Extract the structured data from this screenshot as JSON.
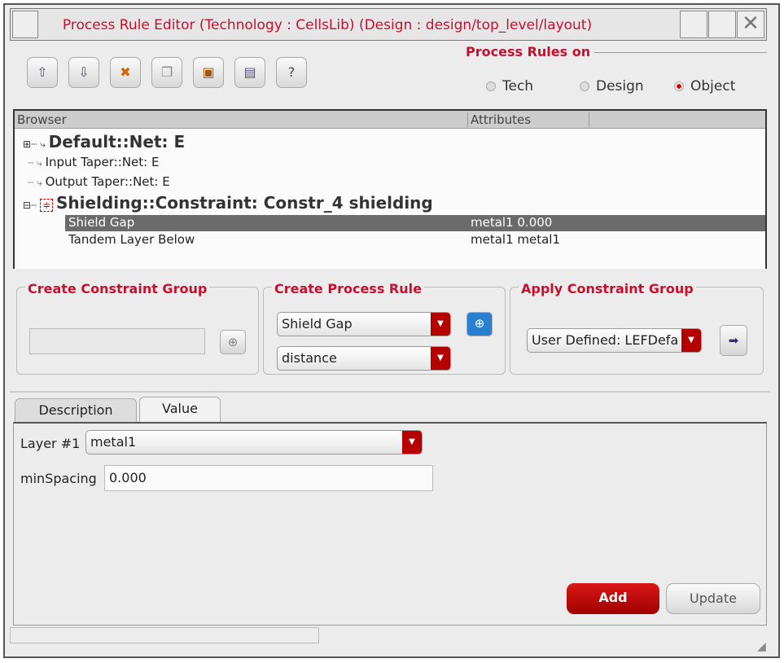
{
  "window": {
    "title": "Process Rule Editor (Technology : CellsLib) (Design : design/top_level/layout)"
  },
  "toolbar": {
    "buttons": [
      {
        "icon": "move-up-icon",
        "glyph": "⇧"
      },
      {
        "icon": "move-down-icon",
        "glyph": "⇩"
      },
      {
        "icon": "delete-icon",
        "glyph": "✖"
      },
      {
        "icon": "copy-icon",
        "glyph": "❐"
      },
      {
        "icon": "paste-icon",
        "glyph": "▣"
      },
      {
        "icon": "save-icon",
        "glyph": "▤"
      },
      {
        "icon": "help-icon",
        "glyph": "?"
      }
    ]
  },
  "rules_on": {
    "label": "Process Rules on",
    "options": [
      "Tech",
      "Design",
      "Object"
    ],
    "selected": "Object"
  },
  "browser": {
    "columns": [
      "Browser",
      "Attributes"
    ],
    "rows": [
      {
        "label": "Default::Net: E",
        "attr": "",
        "expander": "+"
      },
      {
        "label": "Input Taper::Net: E",
        "attr": ""
      },
      {
        "label": "Output Taper::Net: E",
        "attr": ""
      },
      {
        "label": "Shielding::Constraint: Constr_4 shielding",
        "attr": "",
        "expander": "-"
      },
      {
        "label": "Shield Gap",
        "attr": "metal1 0.000",
        "selected": true
      },
      {
        "label": "Tandem Layer Below",
        "attr": "metal1 metal1"
      }
    ]
  },
  "create_group": {
    "label": "Create Constraint Group",
    "value": ""
  },
  "create_rule": {
    "label": "Create Process Rule",
    "rule": "Shield Gap",
    "type": "distance"
  },
  "apply_group": {
    "label": "Apply Constraint Group",
    "value": "User Defined: LEFDefa"
  },
  "tabs": [
    "Description",
    "Value"
  ],
  "active_tab": "Value",
  "value": {
    "layer_label": "Layer #1",
    "layer": "metal1",
    "minspacing_label": "minSpacing",
    "minspacing": "0.000"
  },
  "actions": {
    "add": "Add",
    "update": "Update"
  }
}
